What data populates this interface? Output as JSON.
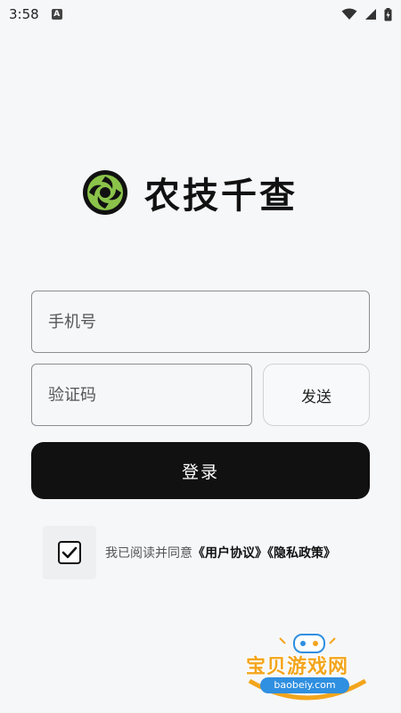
{
  "status_bar": {
    "time": "3:58",
    "notification_badge": "A"
  },
  "brand": {
    "name": "农技千查",
    "logo_colors": [
      "#111111",
      "#8bc34a"
    ]
  },
  "login_form": {
    "phone_placeholder": "手机号",
    "code_placeholder": "验证码",
    "send_label": "发送",
    "login_label": "登录"
  },
  "agreement": {
    "checked": true,
    "prefix": "我已阅读并同意",
    "user_agreement": "《用户协议》",
    "privacy_policy": "《隐私政策》"
  },
  "watermark": {
    "title": "宝贝游戏网",
    "url": "baobeiy.com"
  },
  "colors": {
    "accent": "#111111",
    "background": "#f6f7f9",
    "logo_green": "#8bc34a"
  }
}
